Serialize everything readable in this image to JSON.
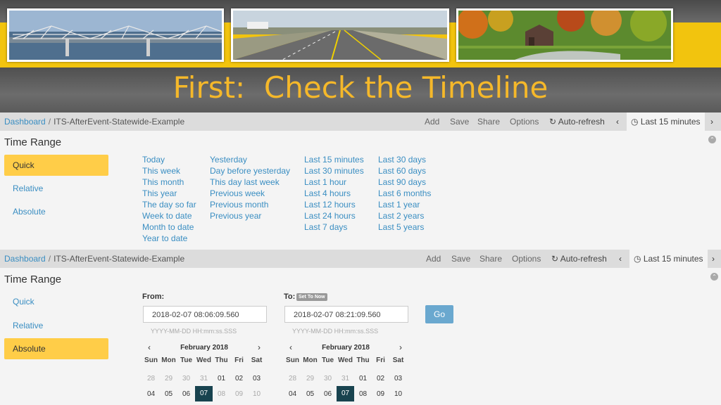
{
  "slide": {
    "title": "First:  Check the Timeline"
  },
  "navbar": {
    "dashboard": "Dashboard",
    "separator": "/",
    "name": "ITS-AfterEvent-Statewide-Example",
    "add": "Add",
    "save": "Save",
    "share": "Share",
    "options": "Options",
    "autorefresh_icon": "refresh-icon",
    "autorefresh": "Auto-refresh",
    "prev": "‹",
    "next": "›",
    "clock_icon": "clock-icon",
    "range": "Last 15 minutes"
  },
  "panel_top": {
    "heading": "Time Range",
    "tabs": [
      "Quick",
      "Relative",
      "Absolute"
    ],
    "active_tab": "Quick",
    "quick_cols": [
      [
        "Today",
        "This week",
        "This month",
        "This year",
        "The day so far",
        "Week to date",
        "Month to date",
        "Year to date"
      ],
      [
        "Yesterday",
        "Day before yesterday",
        "This day last week",
        "Previous week",
        "Previous month",
        "Previous year"
      ],
      [
        "Last 15 minutes",
        "Last 30 minutes",
        "Last 1 hour",
        "Last 4 hours",
        "Last 12 hours",
        "Last 24 hours",
        "Last 7 days"
      ],
      [
        "Last 30 days",
        "Last 60 days",
        "Last 90 days",
        "Last 6 months",
        "Last 1 year",
        "Last 2 years",
        "Last 5 years"
      ]
    ]
  },
  "panel_bottom": {
    "heading": "Time Range",
    "tabs": [
      "Quick",
      "Relative",
      "Absolute"
    ],
    "active_tab": "Absolute",
    "from_label": "From:",
    "to_label": "To:",
    "set_to_now": "Set To Now",
    "from_value": "2018-02-07 08:06:09.560",
    "to_value": "2018-02-07 08:21:09.560",
    "format_hint": "YYYY-MM-DD HH:mm:ss.SSS",
    "go": "Go",
    "calendar": {
      "month": "February 2018",
      "prev": "‹",
      "next": "›",
      "days_of_week": [
        "Sun",
        "Mon",
        "Tue",
        "Wed",
        "Thu",
        "Fri",
        "Sat"
      ],
      "week1": [
        "28",
        "29",
        "30",
        "31",
        "01",
        "02",
        "03"
      ],
      "week2": [
        "04",
        "05",
        "06",
        "07",
        "08",
        "09",
        "10"
      ],
      "selected": "07"
    }
  },
  "colors": {
    "banner_yellow": "#f2c40e",
    "title": "#f5b82a",
    "active_tab": "#ffcd48",
    "link": "#3a8ec2",
    "selected_day": "#18434f",
    "go_button": "#6aa8cf"
  }
}
